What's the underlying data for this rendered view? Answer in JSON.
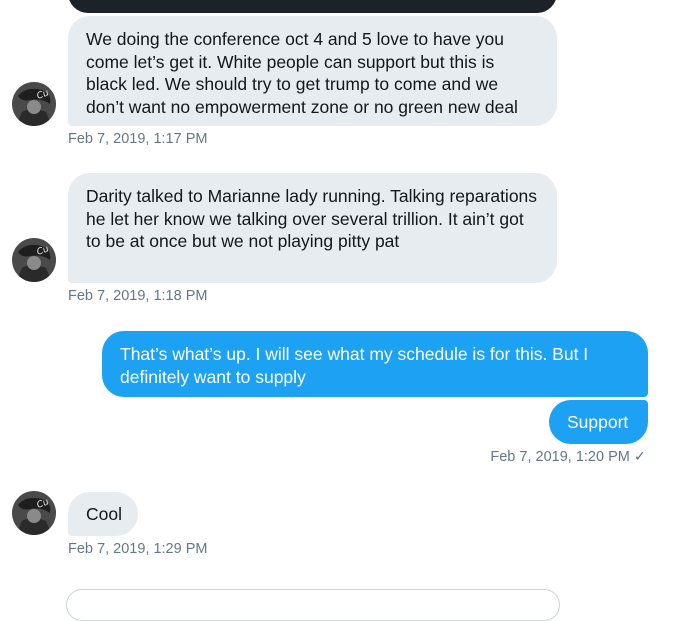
{
  "messages": [
    {
      "text": "We doing the conference oct 4 and 5 love to have you come let’s get it. White people can support but this is black led. We should try to get trump to come and we don’t want no empowerment zone or no green new deal",
      "timestamp": "Feb 7, 2019, 1:17 PM"
    },
    {
      "text": "Darity talked to Marianne lady running. Talking reparations he let her know we talking over several trillion. It ain’t got to be at once but we not playing pitty pat",
      "timestamp": "Feb 7, 2019, 1:18 PM"
    },
    {
      "text": "That’s what’s up. I will see what my schedule is for this. But I definitely want to supply"
    },
    {
      "text": "Support",
      "timestamp": "Feb 7, 2019, 1:20 PM",
      "status_glyph": "✓"
    },
    {
      "text": "Cool",
      "timestamp": "Feb 7, 2019, 1:29 PM"
    }
  ],
  "colors": {
    "incoming_bubble": "#e6ecf0",
    "outgoing_bubble": "#1da1f2",
    "timestamp": "#657786",
    "previous_bubble": "#1c2228"
  },
  "icons": {
    "avatar": "user-avatar-photo",
    "read_receipt": "checkmark-icon"
  }
}
